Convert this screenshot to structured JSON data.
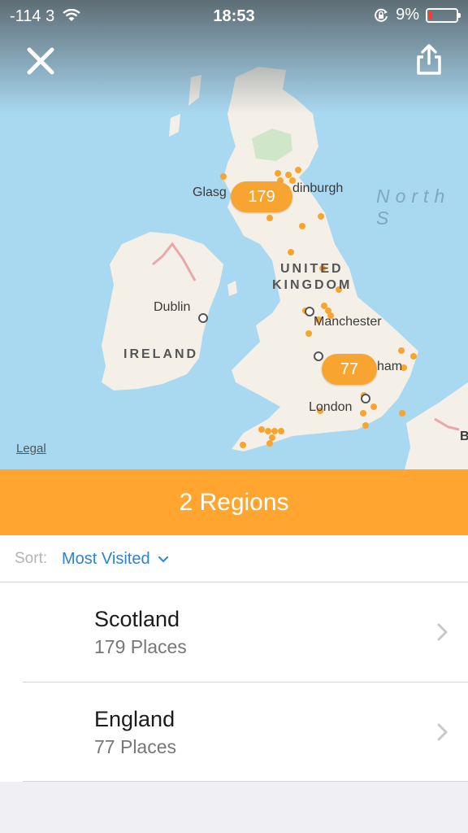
{
  "status_bar": {
    "signal": "-114 3",
    "time": "18:53",
    "battery": "9%",
    "battery_level": 0.09
  },
  "map": {
    "labels": {
      "glasgow": "Glasg",
      "edinburgh": "dinburgh",
      "north_sea": "North S",
      "uk_line1": "UNITED",
      "uk_line2": "KINGDOM",
      "dublin": "Dublin",
      "ireland": "IRELAND",
      "manchester": "Manchester",
      "birmingham": "ham",
      "london": "London",
      "b_edge": "B"
    },
    "clusters": {
      "scotland": "179",
      "england": "77"
    },
    "legal": "Legal",
    "colors": {
      "sea": "#a9d8f1",
      "land": "#f4f0e8",
      "cluster": "#f7a530"
    }
  },
  "banner": {
    "title": "2 Regions",
    "color": "#ffa530"
  },
  "sort": {
    "label": "Sort:",
    "value": "Most Visited"
  },
  "regions": [
    {
      "name": "Scotland",
      "places": "179 Places"
    },
    {
      "name": "England",
      "places": "77 Places"
    }
  ]
}
